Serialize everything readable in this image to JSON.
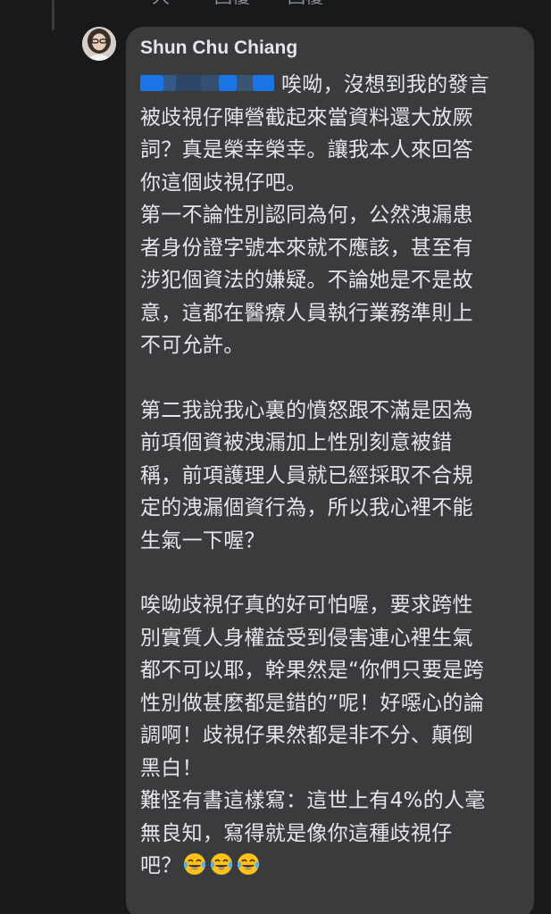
{
  "top_actions": {
    "like": "大",
    "reply": "回覆",
    "share": "回覆"
  },
  "comment": {
    "author": "Shun Chu Chiang",
    "tagged_name_redacted": true,
    "paragraphs": [
      {
        "lines": [
          "唉呦，沒想到我的發言",
          "被歧視仔陣營截起來當資料還大放厥",
          "詞？真是榮幸榮幸。讓我本人來回答",
          "你這個歧視仔吧。",
          "第一不論性別認同為何，公然洩漏患",
          "者身份證字號本來就不應該，甚至有",
          "涉犯個資法的嫌疑。不論她是不是故",
          "意，這都在醫療人員執行業務準則上",
          "不可允許。"
        ]
      },
      {
        "lines": [
          "第二我說我心裏的憤怒跟不滿是因為",
          "前項個資被洩漏加上性別刻意被錯",
          "稱，前項護理人員就已經採取不合規",
          "定的洩漏個資行為，所以我心裡不能",
          "生氣一下喔？"
        ]
      },
      {
        "lines": [
          "唉呦歧視仔真的好可怕喔，要求跨性",
          "別實質人身權益受到侵害連心裡生氣",
          "都不可以耶，幹果然是“你們只要是跨",
          "性別做甚麼都是錯的”呢！好噁心的論",
          "調啊！歧視仔果然都是非不分、顛倒",
          "黑白！",
          "難怪有書這樣寫：這世上有4%的人毫",
          "無良知，寫得就是像你這種歧視仔",
          "吧？"
        ]
      }
    ],
    "trailing_emoji": [
      "face-with-tears-of-joy",
      "face-with-tears-of-joy",
      "face-with-tears-of-joy"
    ]
  },
  "colors": {
    "background": "#18191a",
    "bubble": "#3a3b3c",
    "text": "#e4e6eb",
    "muted": "#8a8d91",
    "tag_redaction": "#1b74e4"
  }
}
